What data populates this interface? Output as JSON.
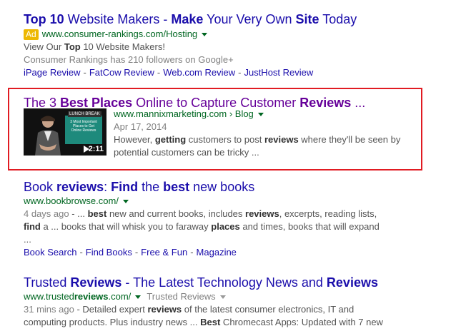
{
  "results": [
    {
      "title_parts": [
        [
          "Top 10",
          true
        ],
        [
          " Website Makers - ",
          false
        ],
        [
          "Make",
          true
        ],
        [
          " Your Very Own ",
          false
        ],
        [
          "Site",
          true
        ],
        [
          " Today",
          false
        ]
      ],
      "ad_label": "Ad",
      "url": "www.consumer-rankings.com/Hosting",
      "line1_parts": [
        [
          "View Our ",
          false
        ],
        [
          "Top",
          true
        ],
        [
          " 10 Website Makers!",
          false
        ]
      ],
      "line2": "Consumer Rankings has 210 followers on Google+",
      "sitelinks": [
        "iPage Review",
        "FatCow Review",
        "Web.com Review",
        "JustHost Review"
      ]
    },
    {
      "title_parts": [
        [
          "The 3 ",
          false
        ],
        [
          "Best Places",
          true
        ],
        [
          " Online to Capture Customer ",
          false
        ],
        [
          "Reviews",
          true
        ],
        [
          " ...",
          false
        ]
      ],
      "url": "www.mannixmarketing.com › Blog",
      "date": "Apr 17, 2014",
      "snippet_parts": [
        [
          "However, ",
          false
        ],
        [
          "getting",
          true
        ],
        [
          " customers to post ",
          false
        ],
        [
          "reviews",
          true
        ],
        [
          " where they'll be seen by potential customers can be tricky ...",
          false
        ]
      ],
      "video": {
        "duration": "2:11",
        "panel_title": "LUNCH BREAK",
        "panel_text": "3 Most Important Places to Get Online Reviews"
      }
    },
    {
      "title_parts": [
        [
          "Book ",
          false
        ],
        [
          "reviews",
          true
        ],
        [
          ": ",
          false
        ],
        [
          "Find",
          true
        ],
        [
          " the ",
          false
        ],
        [
          "best",
          true
        ],
        [
          " new books",
          false
        ]
      ],
      "url": "www.bookbrowse.com/",
      "snippet_parts": [
        [
          "4 days ago",
          "date"
        ],
        [
          " - ... ",
          false
        ],
        [
          "best",
          true
        ],
        [
          " new and current books, includes ",
          false
        ],
        [
          "reviews",
          true
        ],
        [
          ", excerpts, reading lists, ",
          false
        ],
        [
          "find",
          true
        ],
        [
          " a ... books that will whisk you to faraway ",
          false
        ],
        [
          "places",
          true
        ],
        [
          " and times, books that will expand ...",
          false
        ]
      ],
      "sitelinks": [
        "Book Search",
        "Find Books",
        "Free & Fun",
        "Magazine"
      ]
    },
    {
      "title_parts": [
        [
          "Trusted ",
          false
        ],
        [
          "Reviews",
          true
        ],
        [
          " - The Latest Technology News and ",
          false
        ],
        [
          "Reviews",
          true
        ]
      ],
      "url_parts": [
        [
          "www.trusted",
          false
        ],
        [
          "reviews",
          true
        ],
        [
          ".com/",
          false
        ]
      ],
      "cached_label": "Trusted Reviews",
      "snippet_parts": [
        [
          "31 mins ago",
          "date"
        ],
        [
          " - Detailed expert ",
          false
        ],
        [
          "reviews",
          true
        ],
        [
          " of the latest consumer electronics, IT and computing products. Plus industry news ... ",
          false
        ],
        [
          "Best",
          true
        ],
        [
          " Chromecast Apps: Updated with 7 new",
          false
        ]
      ]
    }
  ]
}
